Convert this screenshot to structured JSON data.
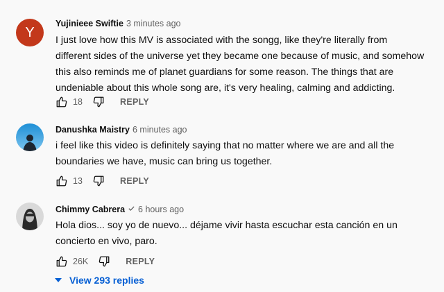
{
  "comments": [
    {
      "avatar_letter": "Y",
      "author": "Yujinieee Swiftie",
      "time": "3 minutes ago",
      "text": "I just love how this MV is associated with the songg, like they're literally from\ndifferent sides of the universe yet they became one because of music, and somehow\nthis also reminds me of planet guardians for some reason. The things that are\nundeniable about this whole song are, it's very healing, calming and addicting.",
      "likes": "18",
      "reply_label": "REPLY"
    },
    {
      "author": "Danushka Maistry",
      "time": "6 minutes ago",
      "text": "i feel like this video is definitely saying that no matter where we are and all the\nboundaries we have, music can bring us together.",
      "likes": "13",
      "reply_label": "REPLY"
    },
    {
      "author": "Chimmy Cabrera",
      "verified_icon": "checkmark-icon",
      "time": "6 hours ago",
      "text": "Hola dios... soy yo de nuevo... déjame vivir hasta escuchar esta canción en un\nconcierto en vivo, paro.",
      "likes": "26K",
      "reply_label": "REPLY"
    }
  ],
  "view_replies": {
    "icon": "caret-down-icon",
    "label": "View 293 replies"
  },
  "colors": {
    "background": "#f9f9f9",
    "avatar_y": "#c3381b",
    "link_blue": "#065fd4",
    "secondary_text": "#606060"
  }
}
